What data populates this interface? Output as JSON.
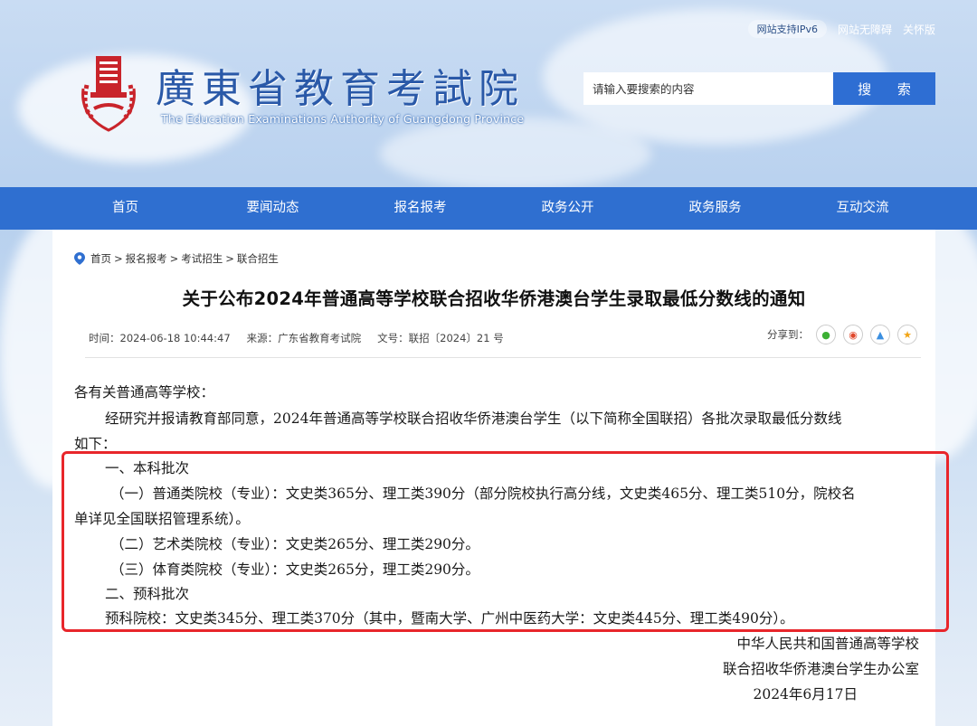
{
  "header": {
    "ipv6_badge": "网站支持IPv6",
    "accessibility_link": "网站无障碍",
    "care_link": "关怀版",
    "site_title": "廣東省教育考試院",
    "site_subtitle": "The Education Examinations Authority of Guangdong Province",
    "search": {
      "placeholder": "请输入要搜索的内容",
      "button_label": "搜 索"
    }
  },
  "nav": {
    "items": [
      "首页",
      "要闻动态",
      "报名报考",
      "政务公开",
      "政务服务",
      "互动交流"
    ]
  },
  "breadcrumb": [
    "首页",
    "报名报考",
    "考试招生",
    "联合招生"
  ],
  "article": {
    "title": "关于公布2024年普通高等学校联合招收华侨港澳台学生录取最低分数线的通知",
    "meta": {
      "time": "时间：2024-06-18 10:44:47",
      "source": "来源：广东省教育考试院",
      "doc_no": "文号：联招〔2024〕21 号"
    },
    "share_label": "分享到：",
    "lines": {
      "salutation": "各有关普通高等学校：",
      "intro1": "经研究并报请教育部同意，2024年普通高等学校联合招收华侨港澳台学生（以下简称全国联招）各批次录取最低分数线",
      "intro2": "如下：",
      "sec1": "一、本科批次",
      "item1a": "（一）普通类院校（专业）：文史类365分、理工类390分（部分院校执行高分线，文史类465分、理工类510分，院校名",
      "item1b": "单详见全国联招管理系统）。",
      "item2": "（二）艺术类院校（专业）：文史类265分、理工类290分。",
      "item3": "（三）体育类院校（专业）：文史类265分，理工类290分。",
      "sec2": "二、预科批次",
      "item4": "预科院校：文史类345分、理工类370分（其中，暨南大学、广州中医药大学：文史类445分、理工类490分）。"
    },
    "signature": {
      "line1": "中华人民共和国普通高等学校",
      "line2": "联合招收华侨港澳台学生办公室",
      "date": "2024年6月17日"
    }
  },
  "colors": {
    "nav_bg": "#2f6fd0",
    "highlight": "#e8262b",
    "title_blue": "#2a59a8"
  }
}
